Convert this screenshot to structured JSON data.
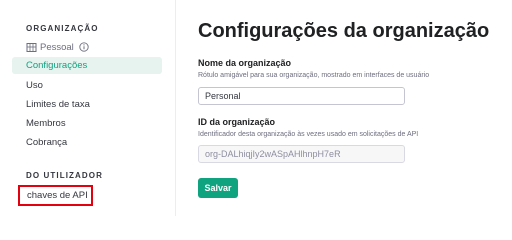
{
  "sidebar": {
    "org_section_label": "ORGANIZAÇÃO",
    "org_name": "Pessoal",
    "items": [
      {
        "label": "Configurações",
        "active": true
      },
      {
        "label": "Uso"
      },
      {
        "label": "Limites de taxa"
      },
      {
        "label": "Membros"
      },
      {
        "label": "Cobrança"
      }
    ],
    "user_section_label": "DO UTILIZADOR",
    "api_keys_label": "chaves de API",
    "highlight_color": "#e3000f"
  },
  "main": {
    "title": "Configurações da organização",
    "name_field": {
      "label": "Nome da organização",
      "description": "Rótulo amigável para sua organização, mostrado em interfaces de usuário",
      "value": "Personal"
    },
    "id_field": {
      "label": "ID da organização",
      "description": "Identificador desta organização às vezes usado em solicitações de API",
      "value": "org-DALhiqjIy2wASpAHlhnpH7eR"
    },
    "save_label": "Salvar",
    "accent_color": "#10a37f"
  }
}
